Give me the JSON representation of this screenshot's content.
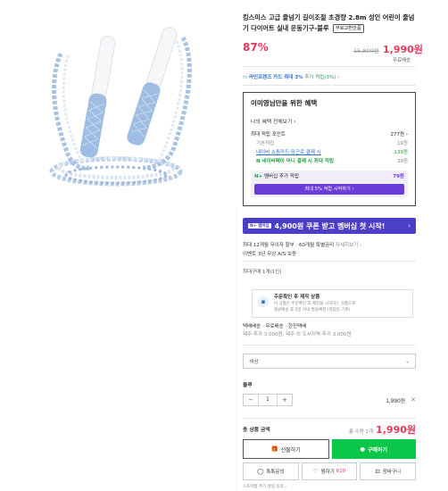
{
  "product": {
    "title": "킹스미스 고급 줄넘기 길이조절 초경량 2.8m 성인 어린이 줄넘기 다이어트 실내 운동기구-블루",
    "badge": "무료교환반품",
    "discount_rate": "87%",
    "original_price": "15,800원",
    "price": "1,990원",
    "shipping_free": "무료배송"
  },
  "promo": {
    "icon": "card-icon",
    "text": "라인프렌즈 카드 최대 3%",
    "text_tail": "추가 적립(3%) ›"
  },
  "benefit": {
    "title": "이미영님만을 위한 혜택",
    "view_all": "나의 혜택 전체보기 ›",
    "max_label": "최대 적립 포인트",
    "max_value": "277원 ›",
    "rows": [
      {
        "label": "기본적립",
        "value": "19원"
      },
      {
        "label": "네이버 쇼핑카드 당근로 결제 시",
        "value": "139원"
      },
      {
        "label": "N 네이버페이 머니 결제 시 최대 적립",
        "value": "39원"
      }
    ],
    "member_label": "멤버십 추가 적립",
    "member_tag": "N+",
    "member_value": "79원",
    "member_button": "최대 5% 적립 시작하기 ›"
  },
  "banner": {
    "tag": "N+ 멤버십",
    "text": "4,900원 쿠폰 받고 멤버십 첫 시작!",
    "arrow": "›"
  },
  "info": {
    "line1": "최대 12개월 무이자 할부 · 60개월 특별금리",
    "line1_link": "자세히보기 ›",
    "line2": "이벤트   3년 무상 A/S 보증"
  },
  "max_purchase": "최대구매 1개(1인)",
  "shipbox": {
    "icon": "truck-icon",
    "title": "주문확인 후 제작 상품",
    "desc1": "이 상품은 주문확인 후 제작을 시작하는 상품으로",
    "desc2": "평균배송 후 5일 이내 발송예정 (영업일 기준)"
  },
  "shipping": {
    "line1": "택배배송 · 무료배송 · 한진택배",
    "line2": "제주 추가 3,000원, 제주 외 도서지역 추가 3,000원"
  },
  "select": {
    "placeholder": "색상",
    "icon": "chevron-down-icon"
  },
  "option": {
    "label": "블루",
    "qty": "1",
    "price": "1,990원",
    "minus": "−",
    "plus": "+",
    "remove": "✕"
  },
  "total": {
    "label": "총 상품 금액",
    "count": "총 수량 1개",
    "price": "1,990원"
  },
  "buttons": {
    "gift": "선물하기",
    "buy": "구매하기",
    "talk": "톡톡문의",
    "wish": "찜하기",
    "wish_count": "610",
    "cart": "장바구니"
  },
  "footer": "스토어찜 추가 알림 동의 ›"
}
